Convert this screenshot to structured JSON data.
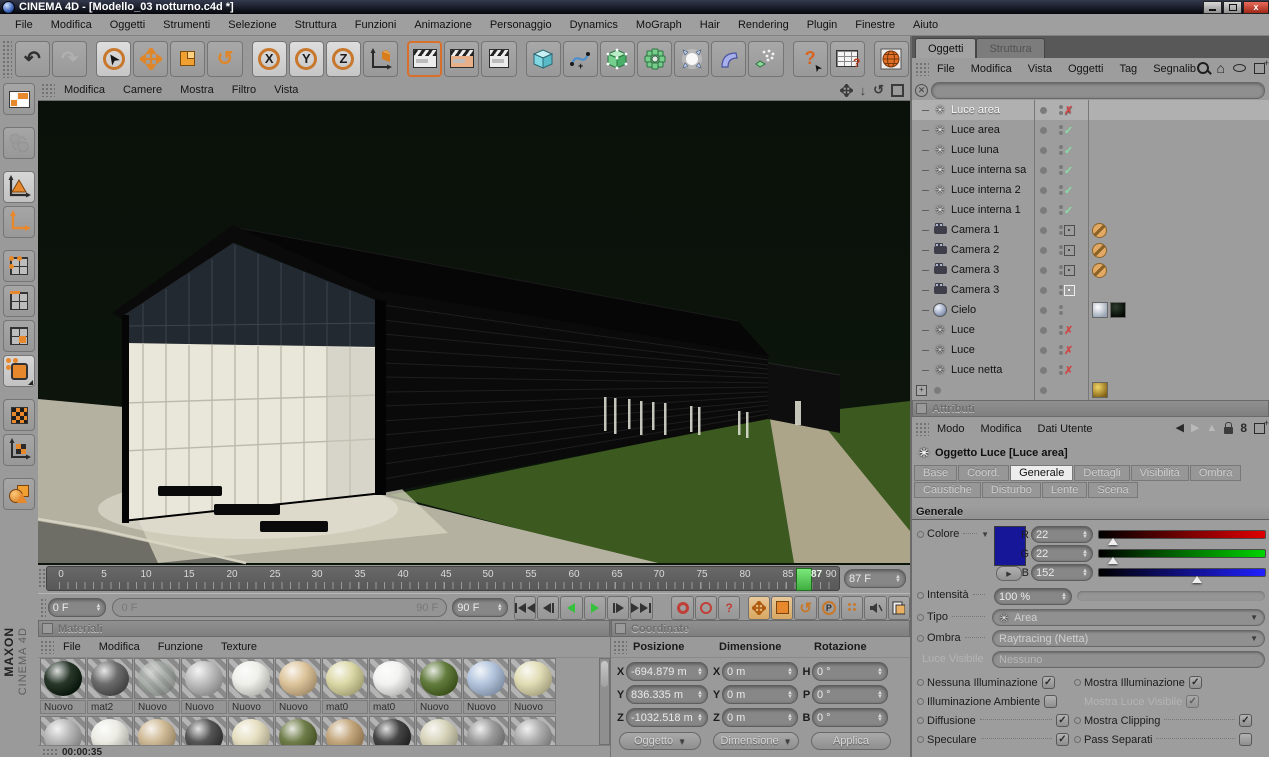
{
  "window": {
    "title": "CINEMA 4D - [Modello_03 notturno.c4d *]"
  },
  "menubar": {
    "items": [
      "File",
      "Modifica",
      "Oggetti",
      "Strumenti",
      "Selezione",
      "Struttura",
      "Funzioni",
      "Animazione",
      "Personaggio",
      "Dynamics",
      "MoGraph",
      "Hair",
      "Rendering",
      "Plugin",
      "Finestre",
      "Aiuto"
    ]
  },
  "viewport": {
    "menu": [
      "Modifica",
      "Camere",
      "Mostra",
      "Filtro",
      "Vista"
    ]
  },
  "timeline": {
    "ticks": [
      "0",
      "5",
      "10",
      "15",
      "20",
      "25",
      "30",
      "35",
      "40",
      "45",
      "50",
      "55",
      "60",
      "65",
      "70",
      "75",
      "80",
      "85",
      "90"
    ],
    "current_frame": "87",
    "frame_field": "87 F",
    "start_field": "0 F",
    "range_start": "0 F",
    "range_end": "90 F",
    "end_field": "90 F"
  },
  "materials": {
    "title": "Materiali",
    "menu": [
      "File",
      "Modifica",
      "Funzione",
      "Texture"
    ],
    "items": [
      {
        "name": "Nuovo",
        "color": "#0c1c0e"
      },
      {
        "name": "mat2",
        "color": "#585858"
      },
      {
        "name": "Nuovo",
        "color": "#9aa39b"
      },
      {
        "name": "Nuovo",
        "color": "#b6b6b6"
      },
      {
        "name": "Nuovo",
        "color": "#eceee6"
      },
      {
        "name": "Nuovo",
        "color": "#d9bd8f"
      },
      {
        "name": "mat0",
        "color": "#d7d39b"
      },
      {
        "name": "mat0",
        "color": "#f1f1ef"
      },
      {
        "name": "Nuovo",
        "color": "#4d6a23"
      },
      {
        "name": "Nuovo",
        "color": "#a9bdd9"
      },
      {
        "name": "Nuovo",
        "color": "#ddd8ab"
      }
    ],
    "row2_colors": [
      "#aeaeae",
      "#e9e9e1",
      "#c9b188",
      "#3e3e3e",
      "#e2dab8",
      "#5c6c31",
      "#bb9a6a",
      "#2c2c2c",
      "#d2ceb2",
      "#8e8e8e",
      "#a2a2a2"
    ]
  },
  "coordinates": {
    "title": "Coordinate",
    "headers": [
      "Posizione",
      "Dimensione",
      "Rotazione"
    ],
    "axis_labels": [
      "X",
      "Y",
      "Z",
      "X",
      "Y",
      "Z",
      "H",
      "P",
      "B"
    ],
    "position": [
      "-694.879 m",
      "836.335 m",
      "-1032.518 m"
    ],
    "dimension": [
      "0 m",
      "0 m",
      "0 m"
    ],
    "rotation": [
      "0 °",
      "0 °",
      "0 °"
    ],
    "buttons": [
      "Oggetto",
      "Dimensione",
      "Applica"
    ]
  },
  "object_manager": {
    "tabs": [
      "Oggetti",
      "Struttura"
    ],
    "menu": [
      "File",
      "Modifica",
      "Vista",
      "Oggetti",
      "Tag",
      "Segnalib"
    ],
    "objects": [
      {
        "name": "Luce area",
        "enabled": false,
        "selected": true
      },
      {
        "name": "Luce area",
        "enabled": true
      },
      {
        "name": "Luce luna",
        "enabled": true
      },
      {
        "name": "Luce interna sa",
        "enabled": true
      },
      {
        "name": "Luce interna 2",
        "enabled": true
      },
      {
        "name": "Luce interna 1",
        "enabled": true
      },
      {
        "name": "Camera 1",
        "protected": true
      },
      {
        "name": "Camera 2",
        "protected": true
      },
      {
        "name": "Camera 3",
        "protected": true
      },
      {
        "name": "Camera 3",
        "active_camera": true
      },
      {
        "name": "Cielo",
        "materials": 2
      },
      {
        "name": "Luce",
        "enabled": false
      },
      {
        "name": "Luce",
        "enabled": false
      },
      {
        "name": "Luce netta",
        "enabled": false
      }
    ]
  },
  "attributes": {
    "title": "Attributi",
    "menu": [
      "Modo",
      "Modifica",
      "Dati Utente"
    ],
    "quicktab": "8",
    "object_label": "Oggetto Luce [Luce area]",
    "tabs_row1": [
      "Base",
      "Coord.",
      "Generale",
      "Dettagli",
      "Visibilità",
      "Ombra"
    ],
    "tabs_row2": [
      "Caustiche",
      "Disturbo",
      "Lente",
      "Scena"
    ],
    "active_tab": "Generale",
    "section_title": "Generale",
    "color_label": "Colore",
    "r_label": "R",
    "g_label": "G",
    "b_label": "B",
    "r": "22",
    "g": "22",
    "b": "152",
    "swatch_color": "#161698",
    "intensity_label": "Intensità",
    "intensity": "100 %",
    "type_label": "Tipo",
    "type_value": "Area",
    "shadow_label": "Ombra",
    "shadow_value": "Raytracing (Netta)",
    "visible_label": "Luce Visibile",
    "visible_value": "Nessuno",
    "checks_left": [
      {
        "label": "Nessuna Illuminazione",
        "checked": true
      },
      {
        "label": "Illuminazione Ambiente",
        "checked": false
      },
      {
        "label": "Diffusione",
        "checked": true
      },
      {
        "label": "Speculare",
        "checked": true
      }
    ],
    "checks_right": [
      {
        "label": "Mostra Illuminazione",
        "checked": true
      },
      {
        "label": "Mostra Luce Visibile",
        "checked": true,
        "disabled": true
      },
      {
        "label": "Mostra Clipping",
        "checked": true
      },
      {
        "label": "Pass Separati",
        "checked": false
      }
    ]
  },
  "statusbar": {
    "time": "00:00:35"
  },
  "brand": {
    "line1": "MAXON",
    "line2": "CINEMA 4D"
  },
  "colors": {
    "accent_orange": "#e0862a",
    "check_green": "#8adfa6",
    "cross_red": "#cf4848",
    "ui_gray": "#9e9e9e",
    "viewport_bg": "#0a120b",
    "swatch_blue": "#161698",
    "playhead_green": "#4fc44f"
  }
}
